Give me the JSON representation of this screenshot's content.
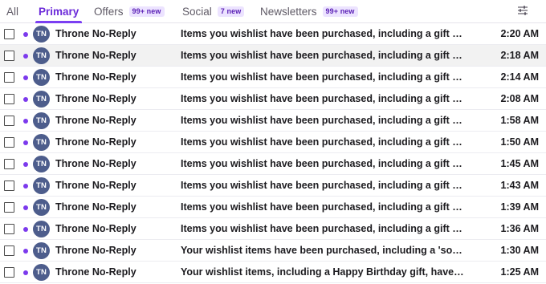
{
  "tabs": [
    {
      "label": "All",
      "badge": "",
      "active": false
    },
    {
      "label": "Primary",
      "badge": "",
      "active": true
    },
    {
      "label": "Offers",
      "badge": "99+ new",
      "active": false
    },
    {
      "label": "Social",
      "badge": "7 new",
      "active": false
    },
    {
      "label": "Newsletters",
      "badge": "99+ new",
      "active": false
    }
  ],
  "toolbar": {
    "filter_icon": "sliders-icon"
  },
  "accent_color": "#7b3ff2",
  "avatar_color": "#4d5d8c",
  "messages": [
    {
      "initials": "TN",
      "sender": "Throne No-Reply",
      "subject": "Items you wishlist have been purchased, including a gift from sim...",
      "time": "2:20 AM",
      "unread": true,
      "hover": false
    },
    {
      "initials": "TN",
      "sender": "Throne No-Reply",
      "subject": "Items you wishlist have been purchased, including a gift from sim...",
      "time": "2:18 AM",
      "unread": true,
      "hover": true
    },
    {
      "initials": "TN",
      "sender": "Throne No-Reply",
      "subject": "Items you wishlist have been purchased, including a gift from sim...",
      "time": "2:14 AM",
      "unread": true,
      "hover": false
    },
    {
      "initials": "TN",
      "sender": "Throne No-Reply",
      "subject": "Items you wishlist have been purchased, including a gift from sim...",
      "time": "2:08 AM",
      "unread": true,
      "hover": false
    },
    {
      "initials": "TN",
      "sender": "Throne No-Reply",
      "subject": "Items you wishlist have been purchased, including a gift from sim...",
      "time": "1:58 AM",
      "unread": true,
      "hover": false
    },
    {
      "initials": "TN",
      "sender": "Throne No-Reply",
      "subject": "Items you wishlist have been purchased, including a gift from sim...",
      "time": "1:50 AM",
      "unread": true,
      "hover": false
    },
    {
      "initials": "TN",
      "sender": "Throne No-Reply",
      "subject": "Items you wishlist have been purchased, including a gift from sim...",
      "time": "1:45 AM",
      "unread": true,
      "hover": false
    },
    {
      "initials": "TN",
      "sender": "Throne No-Reply",
      "subject": "Items you wishlist have been purchased, including a gift from sim...",
      "time": "1:43 AM",
      "unread": true,
      "hover": false
    },
    {
      "initials": "TN",
      "sender": "Throne No-Reply",
      "subject": "Items you wishlist have been purchased, including a gift from sim...",
      "time": "1:39 AM",
      "unread": true,
      "hover": false
    },
    {
      "initials": "TN",
      "sender": "Throne No-Reply",
      "subject": "Items you wishlist have been purchased, including a gift from sim...",
      "time": "1:36 AM",
      "unread": true,
      "hover": false
    },
    {
      "initials": "TN",
      "sender": "Throne No-Reply",
      "subject": "Your wishlist items have been purchased, including a 'something n...",
      "time": "1:30 AM",
      "unread": true,
      "hover": false
    },
    {
      "initials": "TN",
      "sender": "Throne No-Reply",
      "subject": "Your wishlist items, including a Happy Birthday gift, have been pur...",
      "time": "1:25 AM",
      "unread": true,
      "hover": false
    }
  ]
}
